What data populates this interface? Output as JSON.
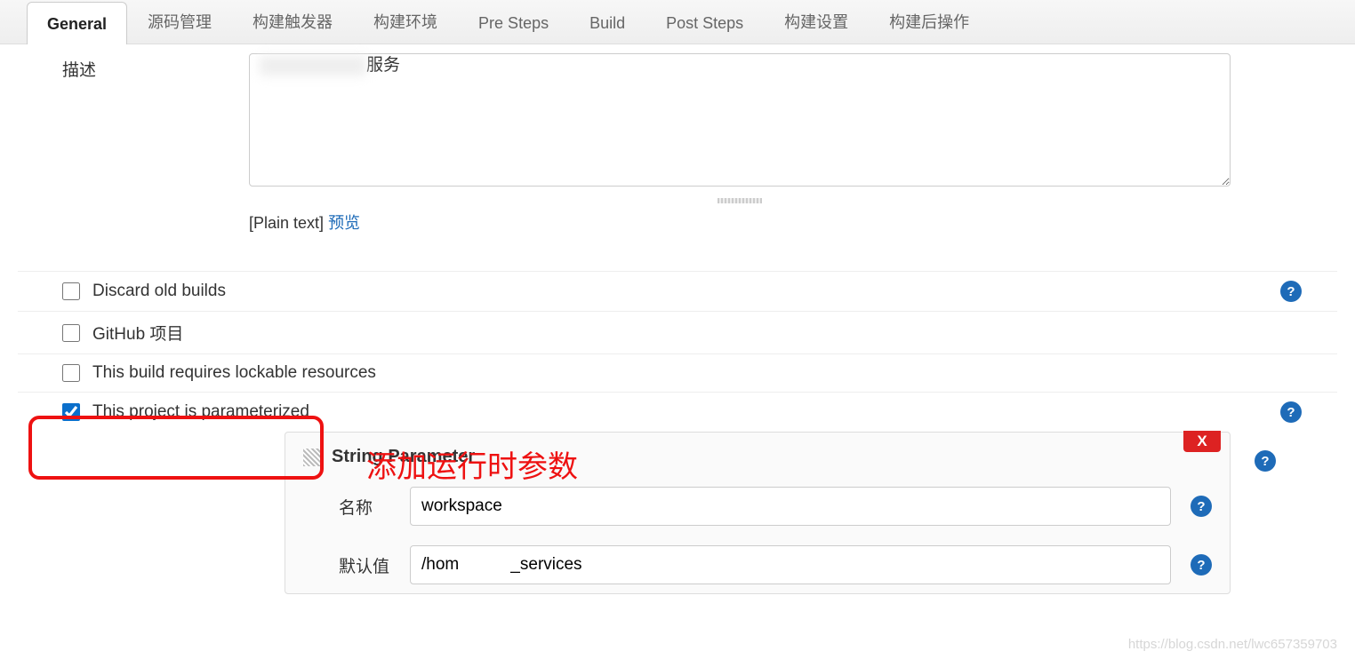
{
  "tabs": {
    "general": "General",
    "scm": "源码管理",
    "triggers": "构建触发器",
    "env": "构建环境",
    "pre": "Pre Steps",
    "build": "Build",
    "post": "Post Steps",
    "settings": "构建设置",
    "postbuild": "构建后操作"
  },
  "description": {
    "label": "描述",
    "value_suffix": "服务",
    "plain_text": "[Plain text]",
    "preview": "预览"
  },
  "options": {
    "discard": "Discard old builds",
    "github": "GitHub 项目",
    "lockable": "This build requires lockable resources",
    "parameterized": "This project is parameterized"
  },
  "annotation": "添加运行时参数",
  "parameter": {
    "title": "String Parameter",
    "delete": "X",
    "name_label": "名称",
    "name_value": "workspace",
    "default_label": "默认值",
    "default_value": "/hom           _services"
  },
  "help_glyph": "?",
  "watermark": "https://blog.csdn.net/lwc657359703"
}
